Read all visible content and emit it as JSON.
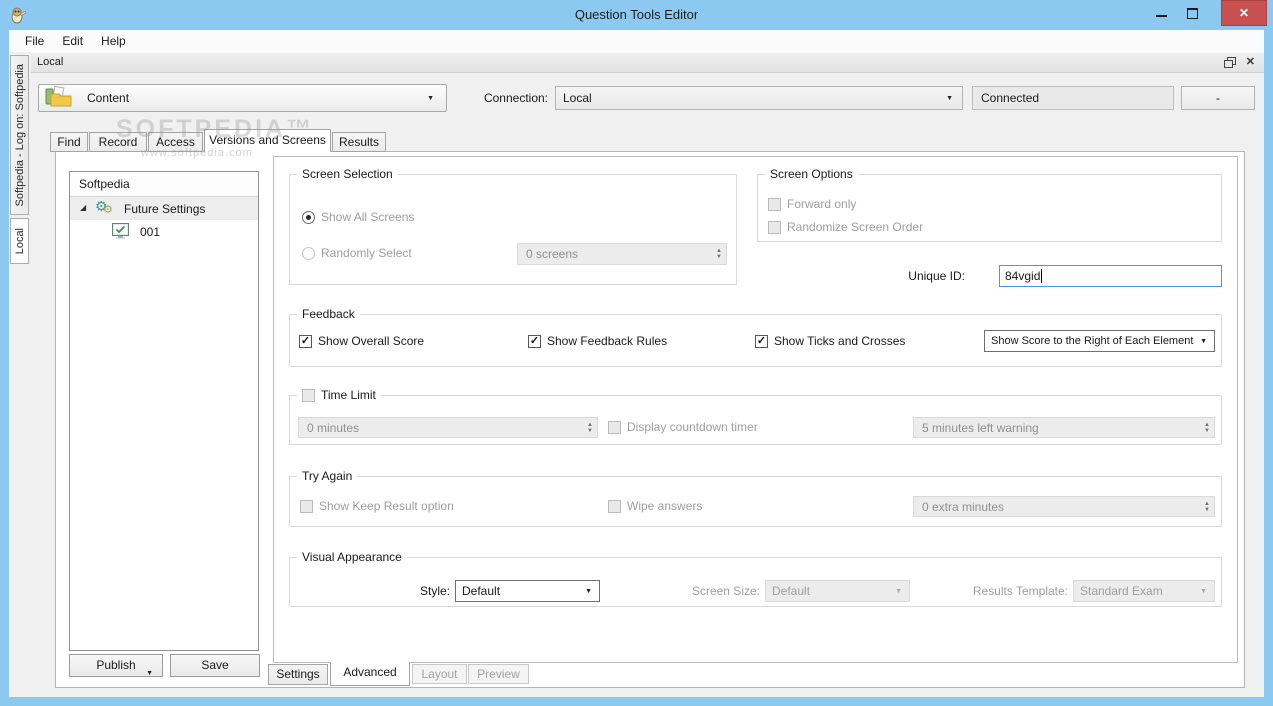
{
  "colors": {
    "titlebar_blue": "#8cc9f0",
    "close_red": "#c75050",
    "focus_blue": "#4f97dd",
    "disabled_text": "#9e9e9e"
  },
  "glyphs": {
    "dropdown": "▼",
    "spin_up": "▲",
    "spin_down": "▼",
    "check": "✓",
    "close": "✕",
    "gear": "⚙",
    "expander": "◢"
  },
  "window": {
    "title": "Question Tools Editor"
  },
  "menu": {
    "items": [
      {
        "label": "File"
      },
      {
        "label": "Edit"
      },
      {
        "label": "Help"
      }
    ]
  },
  "dock": {
    "title": "Local"
  },
  "side_tabs": {
    "logon": "Softpedia - Log on: Softpedia",
    "local": "Local"
  },
  "toolbar": {
    "content": "Content",
    "connection_label": "Connection:",
    "connection_value": "Local",
    "status": "Connected",
    "minus_button": "-"
  },
  "tabs": {
    "find": "Find",
    "record": "Record",
    "access": "Access",
    "versions": "Versions and Screens",
    "results": "Results"
  },
  "tree": {
    "header": "Softpedia",
    "root_item": "Future Settings",
    "child_item": "001"
  },
  "actions": {
    "publish": "Publish",
    "save": "Save"
  },
  "form": {
    "screen_selection": {
      "title": "Screen Selection",
      "show_all": "Show All Screens",
      "randomly_select": "Randomly Select",
      "screens_value": "0 screens"
    },
    "screen_options": {
      "title": "Screen Options",
      "forward_only": "Forward only",
      "randomize_order": "Randomize Screen Order"
    },
    "unique_id": {
      "label": "Unique ID:",
      "value": "84vgid"
    },
    "feedback": {
      "title": "Feedback",
      "overall_score": "Show Overall Score",
      "feedback_rules": "Show Feedback Rules",
      "ticks_crosses": "Show Ticks and Crosses",
      "score_position": "Show Score to the Right of Each Element"
    },
    "time_limit": {
      "title": "Time Limit",
      "minutes_value": "0 minutes",
      "countdown": "Display countdown timer",
      "warning_value": "5 minutes left warning"
    },
    "try_again": {
      "title": "Try Again",
      "keep_result": "Show Keep Result option",
      "wipe_answers": "Wipe answers",
      "extra_value": "0 extra minutes"
    },
    "visual": {
      "title": "Visual Appearance",
      "style_label": "Style:",
      "style_value": "Default",
      "size_label": "Screen Size:",
      "size_value": "Default",
      "template_label": "Results Template:",
      "template_value": "Standard Exam"
    }
  },
  "bottom_tabs": {
    "settings": "Settings",
    "advanced": "Advanced",
    "layout": "Layout",
    "preview": "Preview"
  },
  "watermark": {
    "title": "SOFTPEDIA™",
    "url": "www.softpedia.com"
  }
}
